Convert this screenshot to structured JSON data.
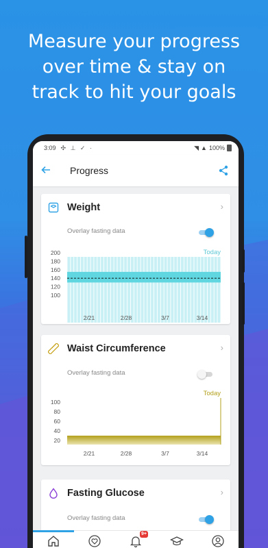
{
  "headline": [
    "Measure your progress",
    "over time & stay on",
    "track to hit your goals"
  ],
  "status_bar": {
    "time": "3:09",
    "battery": "100%"
  },
  "app_bar": {
    "title": "Progress"
  },
  "cards": [
    {
      "name": "Weight",
      "overlay_label": "Overlay fasting data",
      "overlay_on": true
    },
    {
      "name": "Waist Circumference",
      "overlay_label": "Overlay fasting data",
      "overlay_on": false
    },
    {
      "name": "Fasting Glucose",
      "overlay_label": "Overlay fasting data",
      "overlay_on": true
    }
  ],
  "colors": {
    "accent": "#2fa2e6",
    "weight_bar": "#5fd6e0",
    "waist_bar": "#b5a21a",
    "toggle_on": "#2fa2e6"
  },
  "icons": [
    "scale-icon",
    "tape-measure-icon",
    "drop-icon",
    "home-icon",
    "heart-icon",
    "bell-icon",
    "graduation-cap-icon",
    "profile-icon"
  ],
  "tab_bar": {
    "notification_badge": "9+"
  },
  "chart_data": [
    {
      "type": "bar",
      "title": "Weight",
      "today_label": "Today",
      "y_ticks": [
        200,
        180,
        160,
        140,
        120,
        100
      ],
      "ylim": [
        100,
        200
      ],
      "x_ticks": [
        "2/21",
        "2/28",
        "3/7",
        "3/14"
      ],
      "band": [
        130,
        155
      ],
      "dashed_line": 140,
      "grid": false
    },
    {
      "type": "area",
      "title": "Waist Circumference",
      "today_label": "Today",
      "y_ticks": [
        100,
        80,
        60,
        40,
        20
      ],
      "ylim": [
        20,
        100
      ],
      "x_ticks": [
        "2/21",
        "2/28",
        "3/7",
        "3/14"
      ],
      "value": 30,
      "grid": false
    }
  ]
}
